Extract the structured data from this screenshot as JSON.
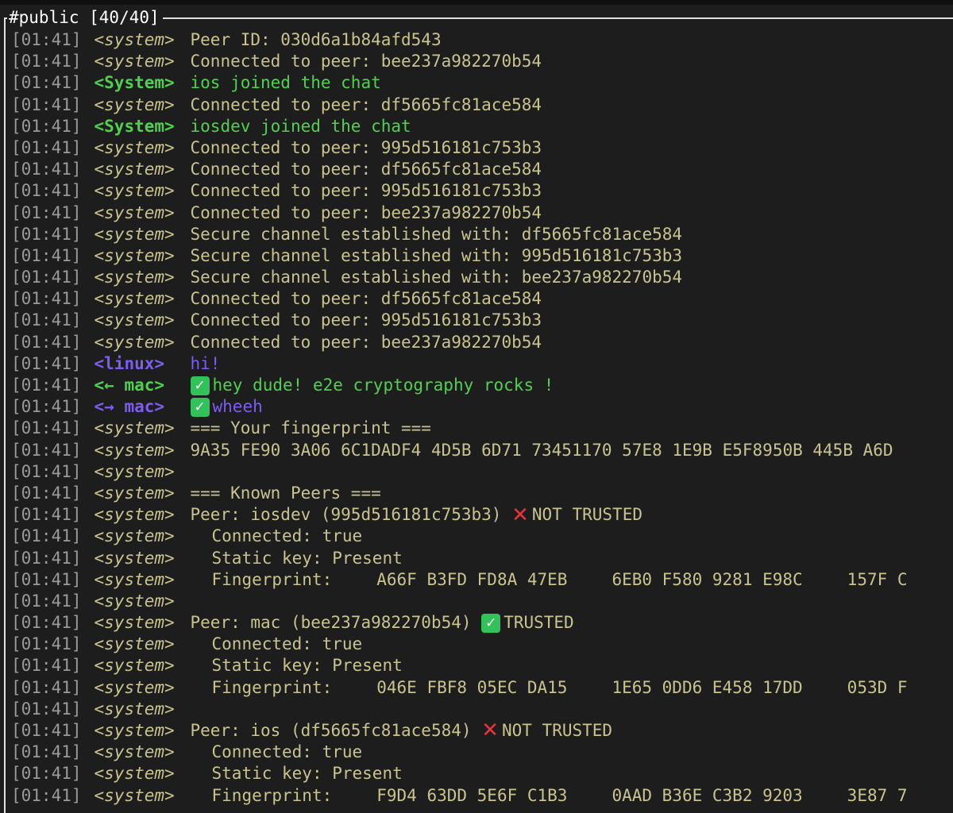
{
  "window": {
    "title": "#public [40/40]"
  },
  "colors": {
    "background": "#1d1d1d",
    "system_nick": "#c8c38f",
    "System_bold": "#4fd14f",
    "purple": "#7c5cf2",
    "cross": "#e5353d",
    "check": "#31c25a"
  },
  "lines": [
    {
      "ts": "[01:41]",
      "nick": "<system>",
      "kind": "system",
      "msg": "Peer ID: 030d6a1b84afd543"
    },
    {
      "ts": "[01:41]",
      "nick": "<system>",
      "kind": "system",
      "msg": "Connected to peer: bee237a982270b54"
    },
    {
      "ts": "[01:41]",
      "nick": "<System>",
      "kind": "System",
      "msg": "ios joined the chat"
    },
    {
      "ts": "[01:41]",
      "nick": "<system>",
      "kind": "system",
      "msg": "Connected to peer: df5665fc81ace584"
    },
    {
      "ts": "[01:41]",
      "nick": "<System>",
      "kind": "System",
      "msg": "iosdev joined the chat"
    },
    {
      "ts": "[01:41]",
      "nick": "<system>",
      "kind": "system",
      "msg": "Connected to peer: 995d516181c753b3"
    },
    {
      "ts": "[01:41]",
      "nick": "<system>",
      "kind": "system",
      "msg": "Connected to peer: df5665fc81ace584"
    },
    {
      "ts": "[01:41]",
      "nick": "<system>",
      "kind": "system",
      "msg": "Connected to peer: 995d516181c753b3"
    },
    {
      "ts": "[01:41]",
      "nick": "<system>",
      "kind": "system",
      "msg": "Connected to peer: bee237a982270b54"
    },
    {
      "ts": "[01:41]",
      "nick": "<system>",
      "kind": "system",
      "msg": "Secure channel established with: df5665fc81ace584"
    },
    {
      "ts": "[01:41]",
      "nick": "<system>",
      "kind": "system",
      "msg": "Secure channel established with: 995d516181c753b3"
    },
    {
      "ts": "[01:41]",
      "nick": "<system>",
      "kind": "system",
      "msg": "Secure channel established with: bee237a982270b54"
    },
    {
      "ts": "[01:41]",
      "nick": "<system>",
      "kind": "system",
      "msg": "Connected to peer: df5665fc81ace584"
    },
    {
      "ts": "[01:41]",
      "nick": "<system>",
      "kind": "system",
      "msg": "Connected to peer: 995d516181c753b3"
    },
    {
      "ts": "[01:41]",
      "nick": "<system>",
      "kind": "system",
      "msg": "Connected to peer: bee237a982270b54"
    },
    {
      "ts": "[01:41]",
      "nick": "<linux>",
      "kind": "linux",
      "msg": "hi!"
    },
    {
      "ts": "[01:41]",
      "nick": "<← mac>",
      "kind": "mac-in",
      "badge": "check",
      "msg": "hey dude! e2e cryptography rocks !"
    },
    {
      "ts": "[01:41]",
      "nick": "<→ mac>",
      "kind": "mac-out",
      "badge": "check",
      "msg": "wheeh"
    },
    {
      "ts": "[01:41]",
      "nick": "<system>",
      "kind": "system",
      "msg": "=== Your fingerprint ==="
    },
    {
      "ts": "[01:41]",
      "nick": "<system>",
      "kind": "system",
      "msg": "9A35 FE90 3A06 6C1DADF4 4D5B 6D71 73451170 57E8 1E9B E5F8950B 445B A6D"
    },
    {
      "ts": "[01:41]",
      "nick": "<system>",
      "kind": "system",
      "msg": ""
    },
    {
      "ts": "[01:41]",
      "nick": "<system>",
      "kind": "system",
      "msg": "=== Known Peers ==="
    },
    {
      "ts": "[01:41]",
      "nick": "<system>",
      "kind": "system",
      "msg": "Peer: iosdev (995d516181c753b3)",
      "badge": "cross",
      "trust": "NOT TRUSTED"
    },
    {
      "ts": "[01:41]",
      "nick": "<system>",
      "kind": "system",
      "indent": true,
      "msg": "Connected: true"
    },
    {
      "ts": "[01:41]",
      "nick": "<system>",
      "kind": "system",
      "indent": true,
      "msg": "Static key: Present"
    },
    {
      "ts": "[01:41]",
      "nick": "<system>",
      "kind": "system",
      "indent": true,
      "fp": [
        "Fingerprint:",
        "A66F B3FD FD8A 47EB",
        "6EB0 F580 9281 E98C",
        "157F C"
      ]
    },
    {
      "ts": "[01:41]",
      "nick": "<system>",
      "kind": "system",
      "msg": ""
    },
    {
      "ts": "[01:41]",
      "nick": "<system>",
      "kind": "system",
      "msg": "Peer: mac (bee237a982270b54)",
      "badge": "check",
      "trust": "TRUSTED"
    },
    {
      "ts": "[01:41]",
      "nick": "<system>",
      "kind": "system",
      "indent": true,
      "msg": "Connected: true"
    },
    {
      "ts": "[01:41]",
      "nick": "<system>",
      "kind": "system",
      "indent": true,
      "msg": "Static key: Present"
    },
    {
      "ts": "[01:41]",
      "nick": "<system>",
      "kind": "system",
      "indent": true,
      "fp": [
        "Fingerprint:",
        "046E FBF8 05EC DA15",
        "1E65 0DD6 E458 17DD",
        "053D F"
      ]
    },
    {
      "ts": "[01:41]",
      "nick": "<system>",
      "kind": "system",
      "msg": ""
    },
    {
      "ts": "[01:41]",
      "nick": "<system>",
      "kind": "system",
      "msg": "Peer: ios (df5665fc81ace584)",
      "badge": "cross",
      "trust": "NOT TRUSTED"
    },
    {
      "ts": "[01:41]",
      "nick": "<system>",
      "kind": "system",
      "indent": true,
      "msg": "Connected: true"
    },
    {
      "ts": "[01:41]",
      "nick": "<system>",
      "kind": "system",
      "indent": true,
      "msg": "Static key: Present"
    },
    {
      "ts": "[01:41]",
      "nick": "<system>",
      "kind": "system",
      "indent": true,
      "fp": [
        "Fingerprint:",
        "F9D4 63DD 5E6F C1B3",
        "0AAD B36E C3B2 9203",
        "3E87 7"
      ]
    }
  ]
}
